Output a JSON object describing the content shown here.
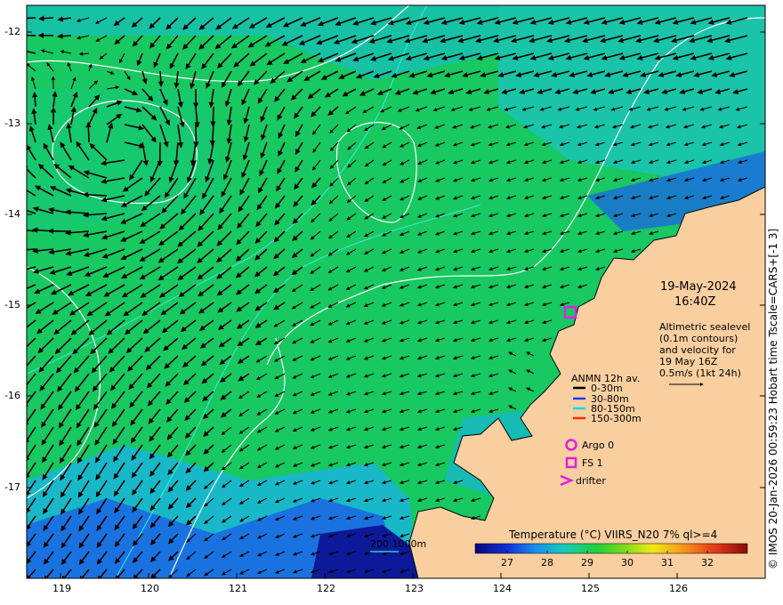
{
  "date": "19-May-2024",
  "time": "16:40Z",
  "altimetry_lines": [
    "Altimetric sealevel",
    "(0.1m contours)",
    "and velocity for",
    "19 May 16Z",
    "0.5m/s (1kt 24h)"
  ],
  "legend": {
    "title": "ANMN 12h av.",
    "items": [
      {
        "label": "0-30m",
        "color": "#000000"
      },
      {
        "label": "30-80m",
        "color": "#1a3cff"
      },
      {
        "label": "80-150m",
        "color": "#00d8ff"
      },
      {
        "label": "150-300m",
        "color": "#ff2a00"
      }
    ],
    "argo": "Argo 0",
    "fs": "FS 1",
    "drifter": "drifter"
  },
  "colorbar": {
    "title": "Temperature (°C) VIIRS_N20 7% ql>=4",
    "min": 26.2,
    "max": 33.0,
    "ticks": [
      "27",
      "28",
      "29",
      "30",
      "31",
      "32"
    ]
  },
  "depth_legend": "200  1000m",
  "credit": "© IMOS 20-Jan-2026 00:59:23 Hobart time Tscale=CARS+[-1 3]",
  "lon_ticks": [
    "119",
    "120",
    "121",
    "122",
    "123",
    "124",
    "125",
    "126"
  ],
  "lat_ticks": [
    "-12",
    "-13",
    "-14",
    "-15",
    "-16",
    "-17"
  ],
  "colors": {
    "land": "#f9cfa0",
    "ocean_green": "#16c93c",
    "ocean_teal": "#18c9a0",
    "ocean_blue": "#1a6fd8",
    "magenta": "#e020e0"
  }
}
